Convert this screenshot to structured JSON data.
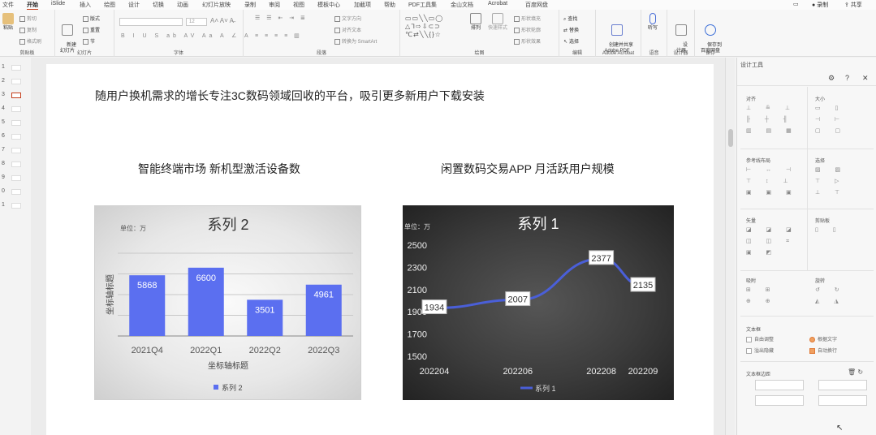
{
  "menu": {
    "tabs": [
      "文件",
      "开始",
      "iSlide",
      "插入",
      "绘图",
      "设计",
      "切换",
      "动画",
      "幻灯片放映",
      "录制",
      "审阅",
      "视图",
      "模板中心",
      "加截项",
      "帮助",
      "PDF工具集",
      "金山文档",
      "Acrobat",
      "百度网盘"
    ],
    "active_tab": "开始",
    "record_label": "录制",
    "share_label": "共享"
  },
  "ribbon": {
    "clipboard": {
      "paste": "粘贴",
      "cut": "剪切",
      "copy": "复制",
      "format": "格式刷",
      "group": "剪贴板"
    },
    "slides": {
      "new_slide": "新建\n幻灯片",
      "layout": "版式",
      "reset": "重置",
      "section": "节",
      "group": "幻灯片"
    },
    "font": {
      "size": "12",
      "group": "字体"
    },
    "paragraph": {
      "text_dir": "文字方向",
      "align_text": "对齐文本",
      "smartart": "转换为 SmartArt",
      "group": "段落"
    },
    "drawing": {
      "arrange": "排列",
      "quick_styles": "快速样式",
      "fill": "形状填充",
      "outline": "形状轮廓",
      "effects": "形状效果",
      "group": "绘图"
    },
    "editing": {
      "find": "查找",
      "replace": "替换",
      "select": "选择",
      "group": "编辑"
    },
    "acrobat": {
      "create": "创建并共享\nAdobe PDF",
      "group": "Adobe Acrobat"
    },
    "voice": {
      "dictate": "听写",
      "group": "语音"
    },
    "designer": {
      "design": "设\n计器",
      "group": "设计器"
    },
    "save": {
      "save_baidu": "保存到\n百度网盘",
      "group": "保存"
    }
  },
  "thumbnails": [
    "1",
    "2",
    "3",
    "4",
    "5",
    "6",
    "7",
    "8",
    "9",
    "0",
    "1"
  ],
  "active_thumbnail": 2,
  "slide": {
    "title": "随用户换机需求的增长专注3C数码领域回收的平台，吸引更多新用户下载安装",
    "left_heading": "智能终端市场 新机型激活设备数",
    "right_heading": "闲置数码交易APP 月活跃用户规模"
  },
  "chart_data": [
    {
      "type": "bar",
      "title": "系列 2",
      "unit_label": "单位：万",
      "categories": [
        "2021Q4",
        "2022Q1",
        "2022Q2",
        "2022Q3"
      ],
      "series": [
        {
          "name": "系列 2",
          "values": [
            5868,
            6600,
            3501,
            4961
          ]
        }
      ],
      "xlabel": "坐标轴标题",
      "ylabel": "坐标轴标题",
      "ylim": [
        0,
        8000
      ],
      "grid": true,
      "legend": "bottom",
      "color": "#5b6ff0"
    },
    {
      "type": "line",
      "title": "系列 1",
      "unit_label": "单位：万",
      "categories": [
        "202204",
        "202206",
        "202208",
        "202209"
      ],
      "x_positions": [
        0,
        2,
        4,
        5
      ],
      "x_tick_labels": [
        "202204",
        "202206",
        "202208",
        "202209"
      ],
      "series": [
        {
          "name": "系列 1",
          "values": [
            1934,
            2007,
            2377,
            2135
          ]
        }
      ],
      "y_ticks": [
        1500,
        1700,
        1900,
        2100,
        2300,
        2500
      ],
      "ylim": [
        1500,
        2500
      ],
      "grid": false,
      "legend": "bottom",
      "color": "#4a5fd8"
    }
  ],
  "panel": {
    "title": "设计工具",
    "align": "对齐",
    "size": "大小",
    "guides": "参考线布局",
    "select": "选择",
    "vector": "矢量",
    "clip": "剪贴板",
    "adsorb": "吸附",
    "rotate": "旋转",
    "textbox": "文本框",
    "auto_adjust": "自由调整",
    "fit_text": "根据文字",
    "overflow": "溢出隐藏",
    "auto_wrap": "自动换行",
    "text_margin": "文本框边距"
  }
}
